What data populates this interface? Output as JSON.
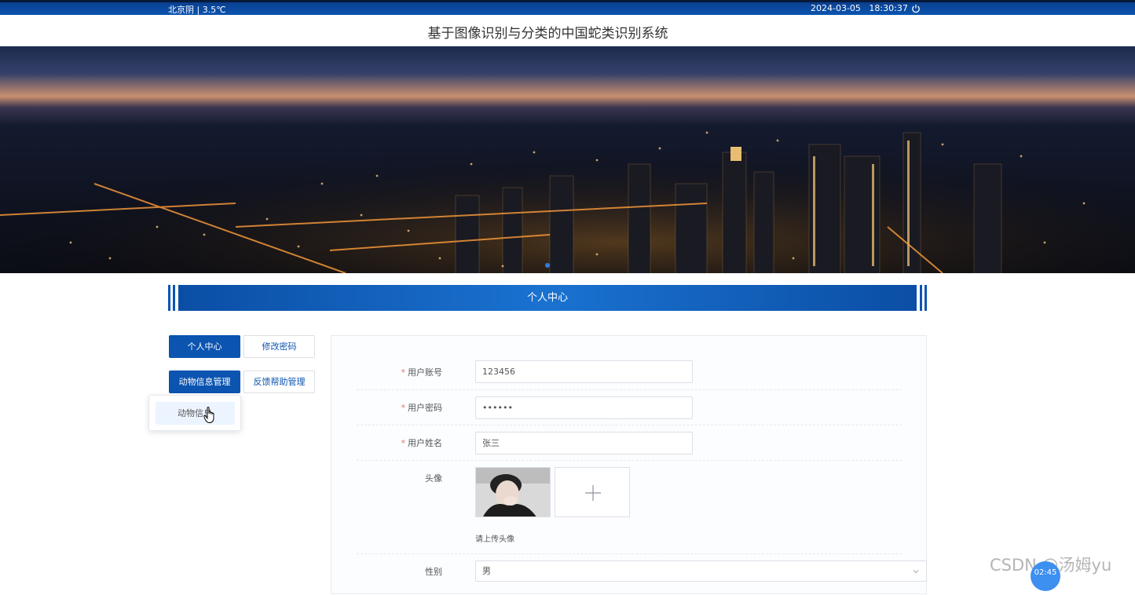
{
  "topbar": {
    "weather": "北京阴 | 3.5℃",
    "datetime": "2024-03-05   18:30:37"
  },
  "site_title": "基于图像识别与分类的中国蛇类识别系统",
  "section_title": "个人中心",
  "nav": {
    "personal_center": "个人中心",
    "change_password": "修改密码",
    "animal_info_manage": "动物信息管理",
    "feedback_help_manage": "反馈帮助管理",
    "dropdown_item": "动物信息"
  },
  "form": {
    "account_label": "用户账号",
    "account_value": "123456",
    "password_label": "用户密码",
    "password_value": "••••••",
    "name_label": "用户姓名",
    "name_value": "张三",
    "avatar_label": "头像",
    "avatar_hint": "请上传头像",
    "gender_label": "性别",
    "gender_value": "男",
    "required_mark": "*"
  },
  "watermark": "CSDN @汤姆yu",
  "timer": "02:45",
  "colors": {
    "primary": "#0b54b0",
    "required": "#f56c6c"
  }
}
